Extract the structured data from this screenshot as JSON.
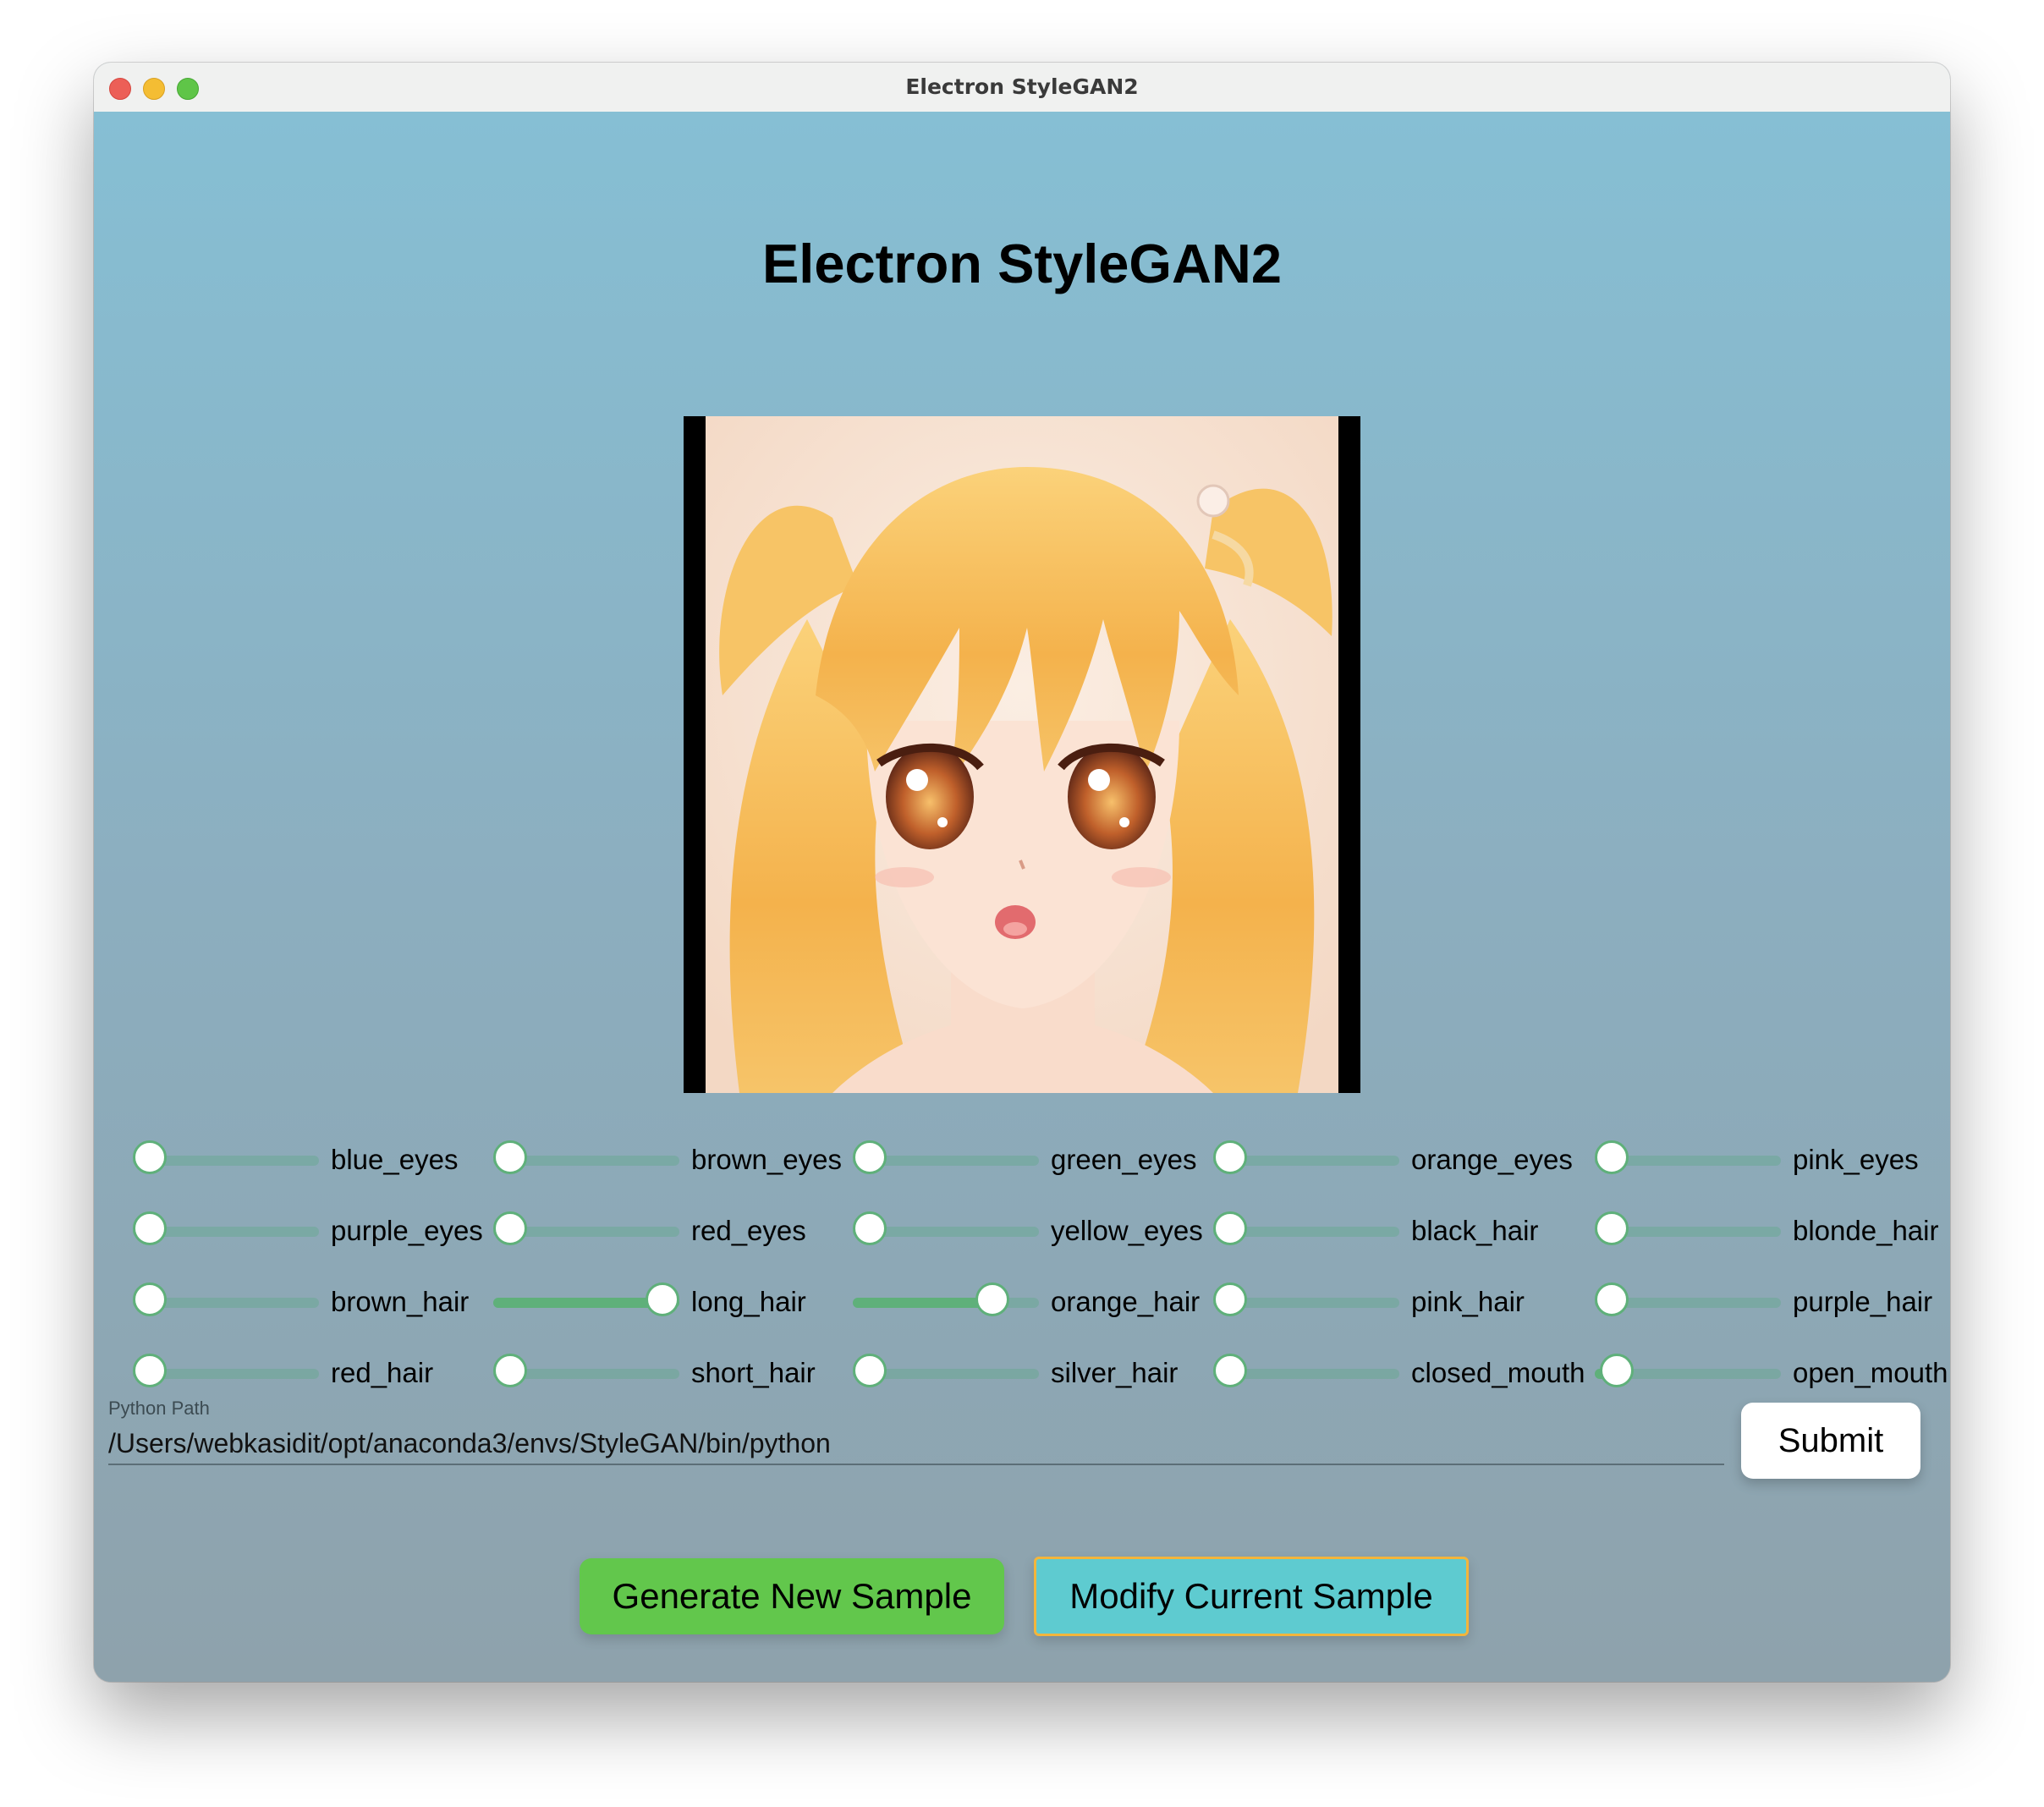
{
  "window": {
    "title": "Electron StyleGAN2"
  },
  "page": {
    "heading": "Electron StyleGAN2"
  },
  "sample_image": {
    "alt": "Generated anime portrait with blonde hair and orange eyes"
  },
  "sliders": [
    {
      "label": "blue_eyes",
      "value": 0.0
    },
    {
      "label": "brown_eyes",
      "value": 0.0
    },
    {
      "label": "green_eyes",
      "value": 0.0
    },
    {
      "label": "orange_eyes",
      "value": 0.0
    },
    {
      "label": "pink_eyes",
      "value": 0.0
    },
    {
      "label": "purple_eyes",
      "value": 0.0
    },
    {
      "label": "red_eyes",
      "value": 0.0
    },
    {
      "label": "yellow_eyes",
      "value": 0.0
    },
    {
      "label": "black_hair",
      "value": 0.0
    },
    {
      "label": "blonde_hair",
      "value": 0.0
    },
    {
      "label": "brown_hair",
      "value": 0.0
    },
    {
      "label": "long_hair",
      "value": 1.0
    },
    {
      "label": "orange_hair",
      "value": 0.75
    },
    {
      "label": "pink_hair",
      "value": 0.0
    },
    {
      "label": "purple_hair",
      "value": 0.0
    },
    {
      "label": "red_hair",
      "value": 0.0
    },
    {
      "label": "short_hair",
      "value": 0.0
    },
    {
      "label": "silver_hair",
      "value": 0.0
    },
    {
      "label": "closed_mouth",
      "value": 0.0
    },
    {
      "label": "open_mouth",
      "value": 0.12
    }
  ],
  "python_path": {
    "label": "Python Path",
    "value": "/Users/webkasidit/opt/anaconda3/envs/StyleGAN/bin/python",
    "submit_label": "Submit"
  },
  "actions": {
    "generate_label": "Generate New Sample",
    "modify_label": "Modify Current Sample"
  },
  "colors": {
    "slider_accent": "#5fb07a",
    "generate_button": "#62c74c",
    "modify_button": "#5ecbd0",
    "modify_border": "#f3b53b"
  }
}
